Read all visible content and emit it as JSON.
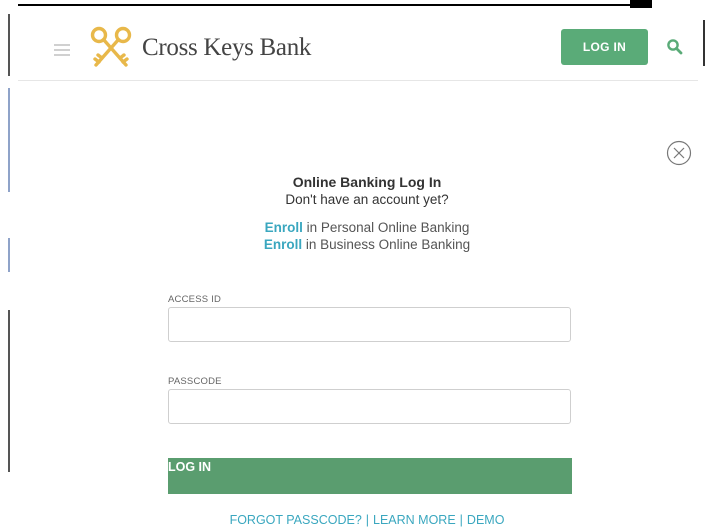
{
  "header": {
    "brand_name": "Cross Keys Bank",
    "login_label": "LOG IN",
    "logo_icon": "crossed-keys-icon",
    "menu_icon": "hamburger-icon",
    "search_icon": "search-icon",
    "accent_color": "#5aab78",
    "logo_color": "#e8b84a"
  },
  "login_panel": {
    "close_icon": "close-circle-icon",
    "title": "Online Banking Log In",
    "subtitle": "Don't have an account yet?",
    "enroll_personal": {
      "link": "Enroll",
      "text": " in Personal Online Banking"
    },
    "enroll_business": {
      "link": "Enroll",
      "text": " in Business Online Banking"
    },
    "access_id": {
      "label": "ACCESS ID",
      "value": "",
      "placeholder": ""
    },
    "passcode": {
      "label": "PASSCODE",
      "value": "",
      "placeholder": ""
    },
    "submit_label": "LOG IN",
    "submit_color": "#5a9d6f",
    "link_color": "#3aa7bf"
  },
  "footer_links": {
    "forgot": "FORGOT PASSCODE?",
    "sep": "|",
    "learn": "LEARN MORE",
    "demo": "DEMO"
  }
}
